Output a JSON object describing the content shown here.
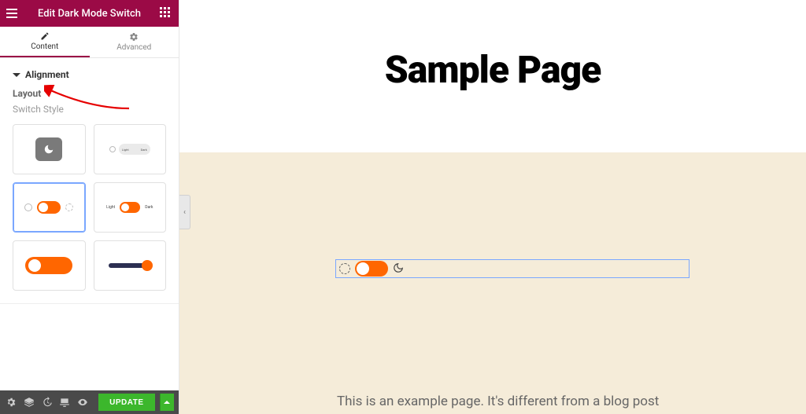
{
  "header": {
    "title": "Edit Dark Mode Switch"
  },
  "tabs": {
    "content": "Content",
    "advanced": "Advanced"
  },
  "section": {
    "alignment": "Alignment"
  },
  "fields": {
    "layout": "Layout",
    "switch_style": "Switch Style"
  },
  "style_cards": {
    "s2_light": "Light",
    "s2_dark": "Dark",
    "s4_light": "Light",
    "s4_dark": "Dark"
  },
  "footer": {
    "update": "UPDATE"
  },
  "preview": {
    "title": "Sample Page",
    "body_text": "This is an example page. It's different from a blog post"
  },
  "colors": {
    "brand": "#9b0a46",
    "accent": "#ff6600",
    "update": "#3cb72c",
    "band": "#f5ecd9",
    "highlight": "#7aa7ff"
  }
}
